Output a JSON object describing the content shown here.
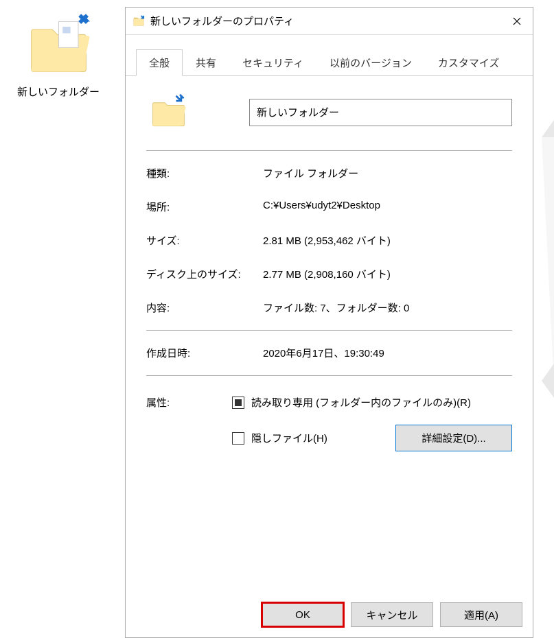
{
  "desktop": {
    "folder_label": "新しいフォルダー"
  },
  "dialog": {
    "title": "新しいフォルダーのプロパティ",
    "tabs": [
      {
        "label": "全般"
      },
      {
        "label": "共有"
      },
      {
        "label": "セキュリティ"
      },
      {
        "label": "以前のバージョン"
      },
      {
        "label": "カスタマイズ"
      }
    ],
    "folder_name": "新しいフォルダー",
    "properties": {
      "type_label": "種類:",
      "type_value": "ファイル フォルダー",
      "location_label": "場所:",
      "location_value": "C:¥Users¥udyt2¥Desktop",
      "size_label": "サイズ:",
      "size_value": "2.81 MB (2,953,462 バイト)",
      "disk_size_label": "ディスク上のサイズ:",
      "disk_size_value": "2.77 MB (2,908,160 バイト)",
      "contents_label": "内容:",
      "contents_value": "ファイル数: 7、フォルダー数: 0",
      "created_label": "作成日時:",
      "created_value": "2020年6月17日、19:30:49"
    },
    "attributes": {
      "section_label": "属性:",
      "readonly_label": "読み取り専用 (フォルダー内のファイルのみ)(R)",
      "hidden_label": "隠しファイル(H)",
      "advanced_button": "詳細設定(D)..."
    },
    "buttons": {
      "ok": "OK",
      "cancel": "キャンセル",
      "apply": "適用(A)"
    }
  }
}
